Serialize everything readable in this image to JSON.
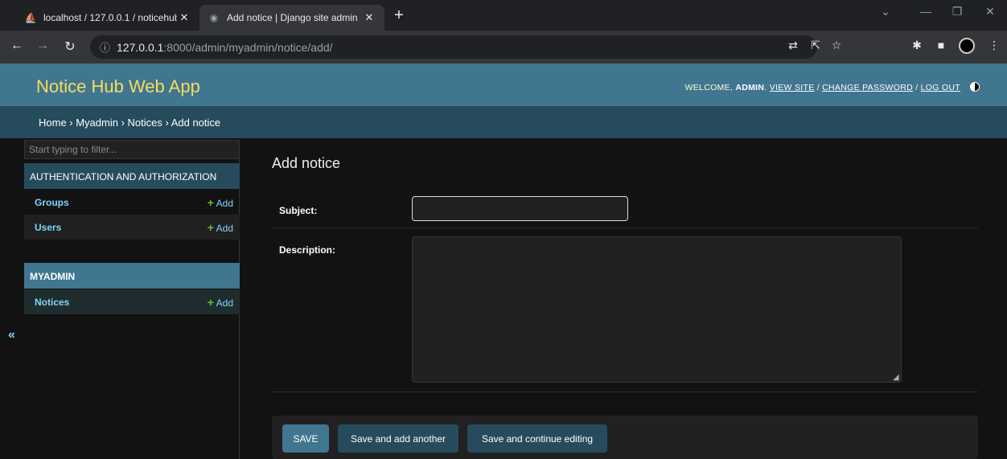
{
  "browser": {
    "tabs": [
      {
        "title": "localhost / 127.0.0.1 / noticehub",
        "favicon": "phpmyadmin-icon"
      },
      {
        "title": "Add notice | Django site admin",
        "favicon": "globe-icon"
      }
    ],
    "url": {
      "host": "127.0.0.1",
      "path": ":8000/admin/myadmin/notice/add/"
    }
  },
  "header": {
    "brand": "Notice Hub Web App",
    "welcome": "WELCOME,",
    "user": "ADMIN",
    "view_site": "VIEW SITE",
    "change_password": "CHANGE PASSWORD",
    "log_out": "LOG OUT",
    "separator": "/"
  },
  "breadcrumbs": "Home › Myadmin › Notices › Add notice",
  "sidebar": {
    "filter_placeholder": "Start typing to filter...",
    "apps": [
      {
        "caption": "AUTHENTICATION AND AUTHORIZATION",
        "models": [
          {
            "name": "Groups",
            "add": "Add"
          },
          {
            "name": "Users",
            "add": "Add"
          }
        ]
      },
      {
        "caption": "MYADMIN",
        "models": [
          {
            "name": "Notices",
            "add": "Add"
          }
        ]
      }
    ],
    "collapse": "«"
  },
  "main": {
    "title": "Add notice",
    "fields": {
      "subject": {
        "label": "Subject:",
        "value": ""
      },
      "description": {
        "label": "Description:",
        "value": ""
      }
    },
    "buttons": {
      "save": "SAVE",
      "save_add_another": "Save and add another",
      "save_continue": "Save and continue editing"
    }
  },
  "colors": {
    "header": "#417690",
    "breadcrumbs": "#264b5d",
    "brand": "#f5dd5d",
    "link": "#81d4fa",
    "add": "#70bf2b"
  }
}
